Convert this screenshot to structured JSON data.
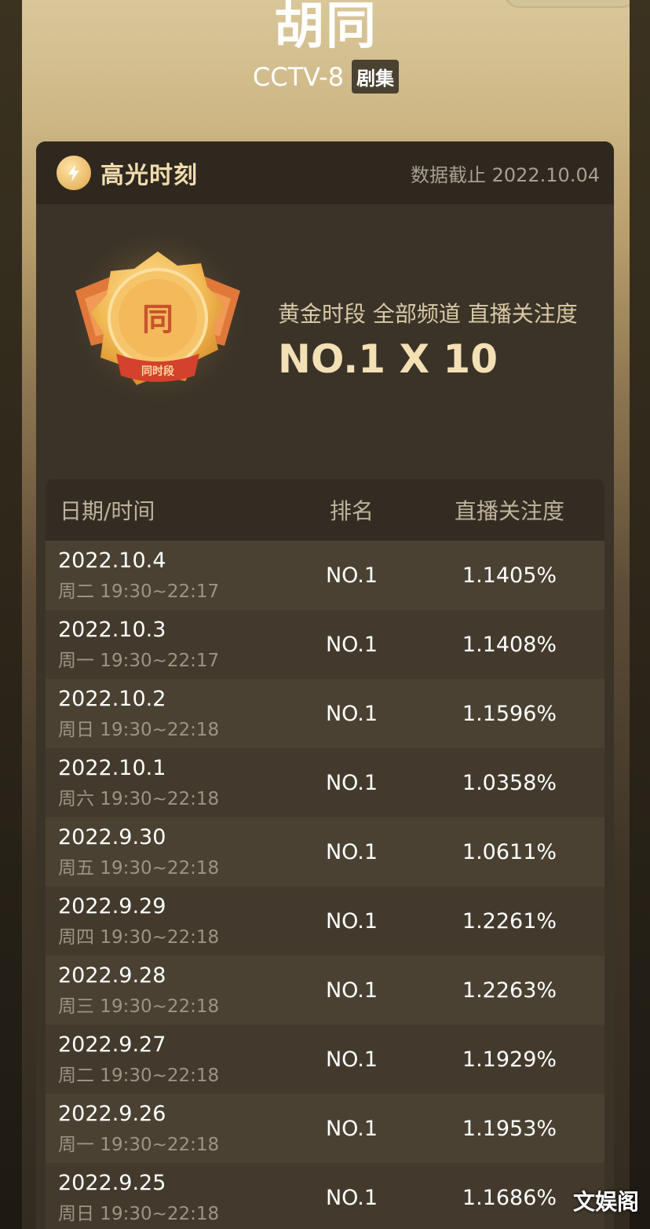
{
  "header": {
    "title": "胡同",
    "channel": "CCTV-8",
    "tag": "剧集"
  },
  "highlight": {
    "title": "高光时刻",
    "data_cutoff": "数据截止 2022.10.04",
    "subtitle": "黄金时段 全部频道 直播关注度",
    "rank_summary": "NO.1 X 10",
    "medal_char": "同",
    "medal_ribbon": "同时段"
  },
  "table": {
    "columns": [
      "日期/时间",
      "排名",
      "直播关注度"
    ],
    "rows": [
      {
        "date": "2022.10.4",
        "slot": "周二 19:30~22:17",
        "rank": "NO.1",
        "value": "1.1405%"
      },
      {
        "date": "2022.10.3",
        "slot": "周一 19:30~22:17",
        "rank": "NO.1",
        "value": "1.1408%"
      },
      {
        "date": "2022.10.2",
        "slot": "周日 19:30~22:18",
        "rank": "NO.1",
        "value": "1.1596%"
      },
      {
        "date": "2022.10.1",
        "slot": "周六 19:30~22:18",
        "rank": "NO.1",
        "value": "1.0358%"
      },
      {
        "date": "2022.9.30",
        "slot": "周五 19:30~22:18",
        "rank": "NO.1",
        "value": "1.0611%"
      },
      {
        "date": "2022.9.29",
        "slot": "周四 19:30~22:18",
        "rank": "NO.1",
        "value": "1.2261%"
      },
      {
        "date": "2022.9.28",
        "slot": "周三 19:30~22:18",
        "rank": "NO.1",
        "value": "1.2263%"
      },
      {
        "date": "2022.9.27",
        "slot": "周二 19:30~22:18",
        "rank": "NO.1",
        "value": "1.1929%"
      },
      {
        "date": "2022.9.26",
        "slot": "周一 19:30~22:18",
        "rank": "NO.1",
        "value": "1.1953%"
      },
      {
        "date": "2022.9.25",
        "slot": "周日 19:30~22:18",
        "rank": "NO.1",
        "value": "1.1686%"
      }
    ]
  },
  "watermark": "文娱阁"
}
